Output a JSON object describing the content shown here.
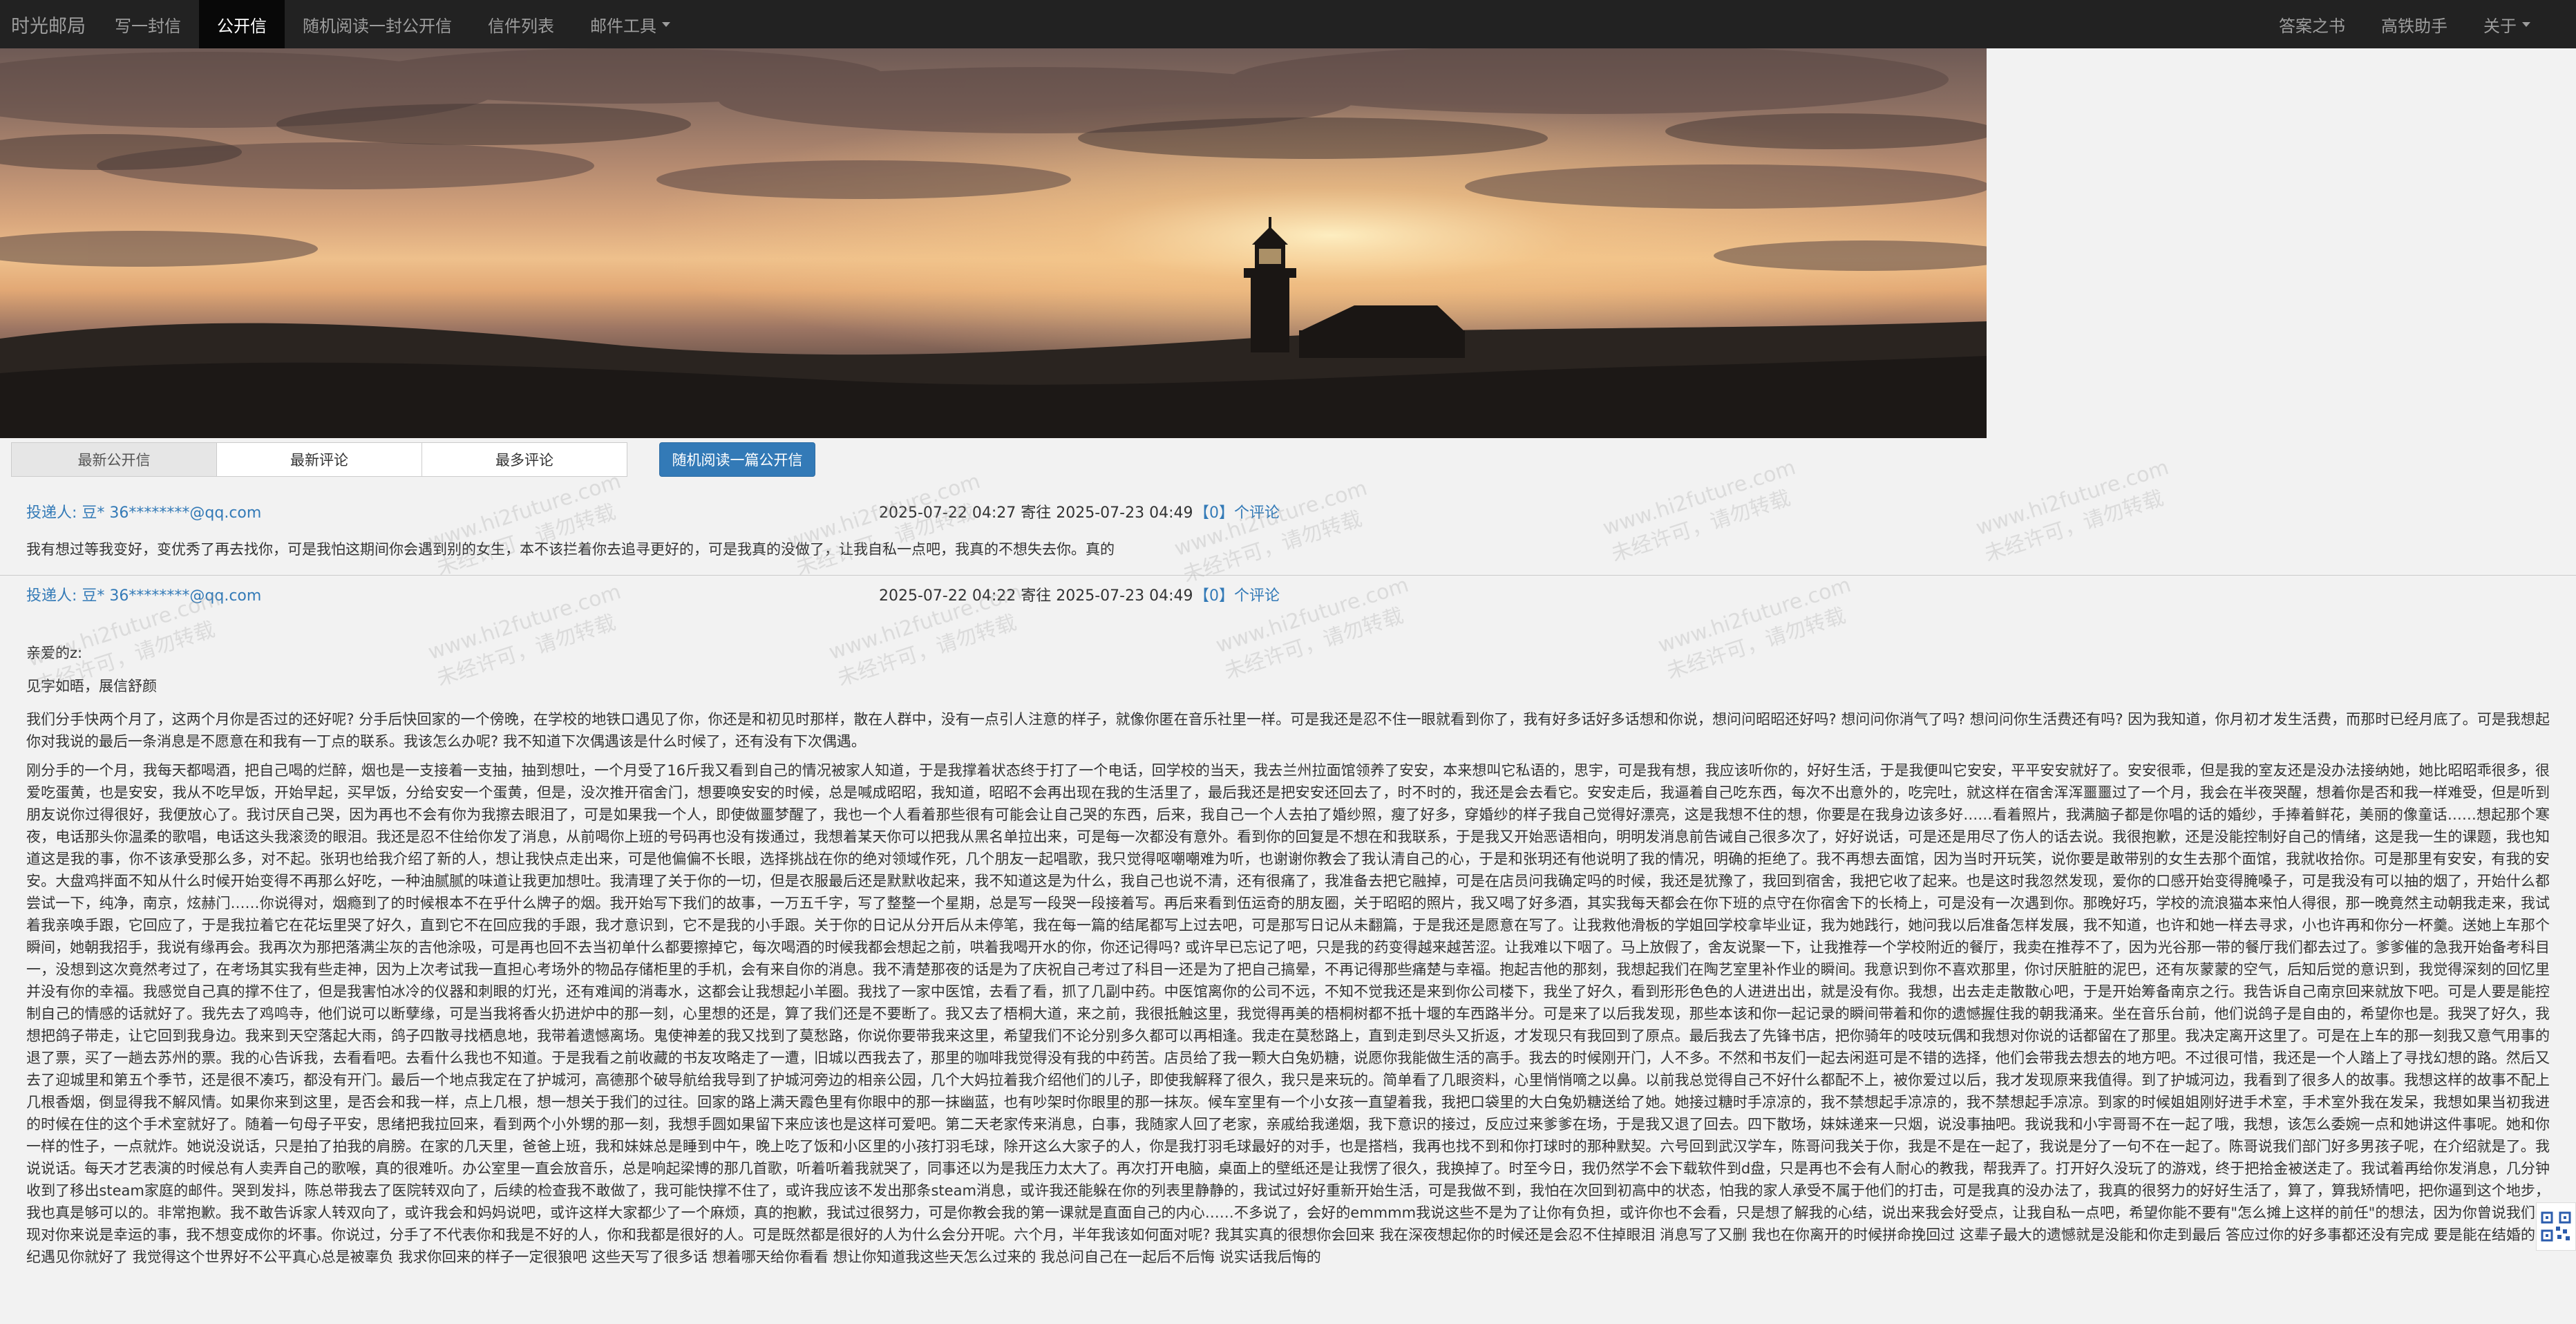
{
  "nav": {
    "brand": "时光邮局",
    "items": [
      "写一封信",
      "公开信",
      "随机阅读一封公开信",
      "信件列表",
      "邮件工具"
    ],
    "right": [
      "答案之书",
      "高铁助手",
      "关于"
    ]
  },
  "tabs": {
    "items": [
      "最新公开信",
      "最新评论",
      "最多评论"
    ],
    "random_button": "随机阅读一篇公开信"
  },
  "letters": [
    {
      "sender": "投递人: 豆* 36********@qq.com",
      "dates": "2025-07-22 04:27 寄往 2025-07-23 04:49",
      "comments": "【0】个评论",
      "excerpt": "我有想过等我变好，变优秀了再去找你，可是我怕这期间你会遇到别的女生，本不该拦着你去追寻更好的，可是我真的没做了，让我自私一点吧，我真的不想失去你。真的"
    },
    {
      "sender": "投递人: 豆* 36********@qq.com",
      "dates": "2025-07-22 04:22 寄往 2025-07-23 04:49",
      "comments": "【0】个评论",
      "salutation": "亲爱的z:",
      "greeting": "见字如晤，展信舒颜",
      "para1": "我们分手快两个月了，这两个月你是否过的还好呢? 分手后快回家的一个傍晚，在学校的地铁口遇见了你，你还是和初见时那样，散在人群中，没有一点引人注意的样子，就像你匿在音乐社里一样。可是我还是忍不住一眼就看到你了，我有好多话好多话想和你说，想问问昭昭还好吗? 想问问你消气了吗? 想问问你生活费还有吗? 因为我知道，你月初才发生活费，而那时已经月底了。可是我想起你对我说的最后一条消息是不愿意在和我有一丁点的联系。我该怎么办呢? 我不知道下次偶遇该是什么时候了，还有没有下次偶遇。",
      "para2": "刚分手的一个月，我每天都喝酒，把自己喝的烂醉，烟也是一支接着一支抽，抽到想吐，一个月受了16斤我又看到自己的情况被家人知道，于是我撑着状态终于打了一个电话，回学校的当天，我去兰州拉面馆领养了安安，本来想叫它私语的，思宇，可是我有想，我应该听你的，好好生活，于是我便叫它安安，平平安安就好了。安安很乖，但是我的室友还是没办法接纳她，她比昭昭乖很多，很爱吃蛋黄，也是安安，我从不吃早饭，开始早起，买早饭，分给安安一个蛋黄，但是，没次推开宿舍门，想要唤安安的时候，总是喊成昭昭，我知道，昭昭不会再出现在我的生活里了，最后我还是把安安还回去了，时不时的，我还是会去看它。安安走后，我逼着自己吃东西，每次不出意外的，吃完吐，就这样在宿舍浑浑噩噩过了一个月，我会在半夜哭醒，想着你是否和我一样难受，但是听到朋友说你过得很好，我便放心了。我讨厌自己哭，因为再也不会有你为我擦去眼泪了，可是如果我一个人，即使做噩梦醒了，我也一个人看着那些很有可能会让自己哭的东西，后来，我自己一个人去拍了婚纱照，瘦了好多，穿婚纱的样子我自己觉得好漂亮，这是我想不住的想，你要是在我身边该多好……看着照片，我满脑子都是你唱的话的婚纱，手捧着鲜花，美丽的像童话……想起那个寒夜，电话那头你温柔的歌唱，电话这头我滚烫的眼泪。我还是忍不住给你发了消息，从前喝你上班的号码再也没有拨通过，我想着某天你可以把我从黑名单拉出来，可是每一次都没有意外。看到你的回复是不想在和我联系，于是我又开始恶语相向，明明发消息前告诫自己很多次了，好好说话，可是还是用尽了伤人的话去说。我很抱歉，还是没能控制好自己的情绪，这是我一生的课题，我也知道这是我的事，你不该承受那么多，对不起。张玥也给我介绍了新的人，想让我快点走出来，可是他偏偏不长眼，选择挑战在你的绝对领域作死，几个朋友一起唱歌，我只觉得呕嘲嘲难为听，也谢谢你教会了我认清自己的心，于是和张玥还有他说明了我的情况，明确的拒绝了。我不再想去面馆，因为当时开玩笑，说你要是敢带别的女生去那个面馆，我就收拾你。可是那里有安安，有我的安安。大盘鸡拌面不知从什么时候开始变得不再那么好吃，一种油腻腻的味道让我更加想吐。我清理了关于你的一切，但是衣服最后还是默默收起来，我不知道这是为什么，我自己也说不清，还有很痛了，我准备去把它融掉，可是在店员问我确定吗的时候，我还是犹豫了，我回到宿舍，我把它收了起来。也是这时我忽然发现，爱你的口感开始变得腌嗓子，可是我没有可以抽的烟了，开始什么都尝试一下，纯净，南京，炫赫门……你说得对，烟瘾到了的时候根本不在乎什么牌子的烟。我开始写下我们的故事，一万五千字，写了整整一个星期，总是写一段哭一段接着写。再后来看到伍运奇的朋友圈，关于昭昭的照片，我又喝了好多酒，其实我每天都会在你下班的点守在你宿舍下的长椅上，可是没有一次遇到你。那晚好巧，学校的流浪猫本来怕人得很，那一晚竟然主动朝我走来，我试着我亲唤手跟，它回应了，于是我拉着它在花坛里哭了好久，直到它不在回应我的手跟，我才意识到，它不是我的小手跟。关于你的日记从分开后从未停笔，我在每一篇的结尾都写上过去吧，可是那写日记从未翻篇，于是我还是愿意在写了。让我救他滑板的学姐回学校拿毕业证，我为她践行，她问我以后准备怎样发展，我不知道，也许和她一样去寻求，小也许再和你分一杯羹。送她上车那个瞬间，她朝我招手，我说有缘再会。我再次为那把落满尘灰的吉他涂吸，可是再也回不去当初单什么都要擦掉它，每次喝酒的时候我都会想起之前，哄着我喝开水的你，你还记得吗? 或许早已忘记了吧，只是我的药变得越来越苦涩。让我难以下咽了。马上放假了，舍友说聚一下，让我推荐一个学校附近的餐厅，我卖在推荐不了，因为光谷那一带的餐厅我们都去过了。爹爹催的急我开始备考科目一，没想到这次竟然考过了，在考场其实我有些走神，因为上次考试我一直担心考场外的物品存储柜里的手机，会有来自你的消息。我不清楚那夜的话是为了庆祝自己考过了科目一还是为了把自己搞晕，不再记得那些痛楚与幸福。抱起吉他的那刻，我想起我们在陶艺室里补作业的瞬间。我意识到你不喜欢那里，你讨厌脏脏的泥巴，还有灰蒙蒙的空气，后知后觉的意识到，我觉得深刻的回忆里并没有你的幸福。我感觉自己真的撑不住了，但是我害怕冰冷的仪器和刺眼的灯光，还有难闻的消毒水，这都会让我想起小羊圈。我找了一家中医馆，去看了看，抓了几副中药。中医馆离你的公司不远，不知不觉我还是来到你公司楼下，我坐了好久，看到形形色色的人进进出出，就是没有你。我想，出去走走散散心吧，于是开始筹备南京之行。我告诉自己南京回来就放下吧。可是人要是能控制自己的情感的话就好了。我先去了鸡鸣寺，他们说可以断孽缘，可是当我将香火扔进炉中的那一刻，心里想的还是，算了我们还是不要断了。我又去了梧桐大道，来之前，我很抵触这里，我觉得再美的梧桐树都不抵十堰的车西路半分。可是来了以后我发现，那些本该和你一起记录的瞬间带着和你的遗憾握住我的朝我涌来。坐在音乐台前，他们说鸽子是自由的，希望你也是。我哭了好久，我想把鸽子带走，让它回到我身边。我来到天空落起大雨，鸽子四散寻找栖息地，我带着遗憾离场。鬼使神差的我又找到了莫愁路，你说你要带我来这里，希望我们不论分别多久都可以再相逢。我走在莫愁路上，直到走到尽头又折返，才发现只有我回到了原点。最后我去了先锋书店，把你骑年的吱吱玩偶和我想对你说的话都留在了那里。我决定离开这里了。可是在上车的那一刻我又意气用事的退了票，买了一趟去苏州的票。我的心告诉我，去看看吧。去看什么我也不知道。于是我看之前收藏的书友攻略走了一遭，旧城以西我去了，那里的咖啡我觉得没有我的中药苦。店员给了我一颗大白兔奶糖，说愿你我能做生活的高手。我去的时候刚开门，人不多。不然和书友们一起去闲逛可是不错的选择，他们会带我去想去的地方吧。不过很可惜，我还是一个人踏上了寻找幻想的路。然后又去了迎城里和第五个季节，还是很不凑巧，都没有开门。最后一个地点我定在了护城河，高德那个破导航给我导到了护城河旁边的相亲公园，几个大妈拉着我介绍他们的儿子，即使我解释了很久，我只是来玩的。简单看了几眼资料，心里悄悄嘀之以鼻。以前我总觉得自己不好什么都配不上，被你爱过以后，我才发现原来我值得。到了护城河边，我看到了很多人的故事。我想这样的故事不配上几根香烟，倒显得我不解风情。如果你来到这里，是否会和我一样，点上几根，想一想关于我们的过往。回家的路上满天霞色里有你眼中的那一抹幽蓝，也有吵架时你眼里的那一抹灰。候车室里有一个小女孩一直望着我，我把口袋里的大白兔奶糖送给了她。她接过糖时手凉凉的，我不禁想起手凉凉的，我不禁想起手凉凉。到家的时候姐姐刚好进手术室，手术室外我在发呆，我想如果当初我进的时候在住的这个手术室就好了。随着一句母子平安，思绪把我拉回来，看到两个小外甥的那一刻，我想手圆如果留下来应该也是这样可爱吧。第二天老家传来消息，白事，我随家人回了老家，亲戚给我递烟，我下意识的接过，反应过来爹爹在场，于是我又退了回去。四下散场，妹妹递来一只烟，说没事抽吧。我说我和小宇哥哥不在一起了哦，我想，该怎么委婉一点和她讲这件事呢。她和你一样的性子，一点就炸。她说没说话，只是拍了拍我的肩膀。在家的几天里，爸爸上班，我和妹妹总是睡到中午，晚上吃了饭和小区里的小孩打羽毛球，除开这么大家子的人，你是我打羽毛球最好的对手，也是搭档，我再也找不到和你打球时的那种默契。六号回到武汉学车，陈哥问我关于你，我是不是在一起了，我说是分了一句不在一起了。陈哥说我们部门好多男孩子呢，在介绍就是了。我说说话。每天才艺表演的时候总有人卖弄自己的歌喉，真的很难听。办公室里一直会放音乐，总是响起梁博的那几首歌，听着听着我就哭了，同事还以为是我压力太大了。再次打开电脑，桌面上的壁纸还是让我愣了很久，我换掉了。时至今日，我仍然学不会下载软件到d盘，只是再也不会有人耐心的教我，帮我弄了。打开好久没玩了的游戏，终于把拾金被送走了。我试着再给你发消息，几分钟收到了移出steam家庭的邮件。哭到发抖，陈总带我去了医院转双向了，后续的检查我不敢做了，我可能快撑不住了，或许我应该不发出那条steam消息，或许我还能躲在你的列表里静静的，我试过好好重新开始生活，可是我做不到，我怕在次回到初高中的状态，怕我的家人承受不属于他们的打击，可是我真的没办法了，我真的很努力的好好生活了，算了，算我矫情吧，把你逼到这个地步，我也真是够可以的。非常抱歉。我不敢告诉家人转双向了，或许我会和妈妈说吧，或许这样大家都少了一个麻烦，真的抱歉，我试过很努力，可是你教会我的第一课就是直面自己的内心……不多说了，会好的emmmm我说这些不是为了让你有负担，或许你也不会看，只是想了解我的心结，说出来我会好受点，让我自私一点吧，希望你能不要有\"怎么摊上这样的前任\"的想法，因为你曾说我们出现对你来说是幸运的事，我不想变成你的坏事。你说过，分手了不代表你和我是不好的人，你和我都是很好的人。可是既然都是很好的人为什么会分开呢。六个月，半年我该如何面对呢? 我其实真的很想你会回来 我在深夜想起你的时候还是会忍不住掉眼泪 消息写了又删 我也在你离开的时候拼命挽回过 这辈子最大的遗憾就是没能和你走到最后 答应过你的好多事都还没有完成 要是能在结婚的年纪遇见你就好了 我觉得这个世界好不公平真心总是被辜负 我求你回来的样子一定很狼吧 这些天写了很多话 想着哪天给你看看 想让你知道我这些天怎么过来的 我总问自己在一起后不后悔 说实话我后悔的"
    }
  ],
  "watermark": [
    "www.hi2future.com",
    "未经许可，请勿转载"
  ]
}
